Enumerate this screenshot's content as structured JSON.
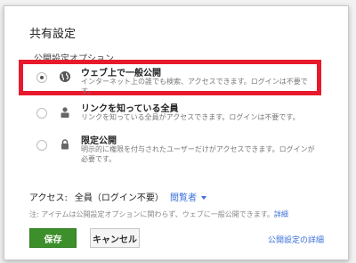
{
  "dialog": {
    "title": "共有設定",
    "options_label": "公開設定オプション",
    "options": [
      {
        "title": "ウェブ上で一般公開",
        "description": "インターネット上の誰でも検索、アクセスできます。ログインは不要です。",
        "icon": "globe-icon",
        "selected": true
      },
      {
        "title": "リンクを知っている全員",
        "description": "リンクを知っている全員がアクセスできます。ログインは不要です。",
        "icon": "people-icon",
        "selected": false
      },
      {
        "title": "限定公開",
        "description": "明示的に権限を付与されたユーザーだけがアクセスできます。ログインが必要です。",
        "icon": "lock-icon",
        "selected": false
      }
    ],
    "access_label": "アクセス:",
    "access_value": "全員（ログイン不要）",
    "role_value": "閲覧者",
    "note_text": "注: アイテムは公開設定オプションに関わらず、ウェブに一般公開できます。",
    "note_link": "詳細",
    "save_label": "保存",
    "cancel_label": "キャンセル",
    "details_link": "公開設定の詳細"
  },
  "colors": {
    "highlight": "#e8192c",
    "primary_button": "#3c8f2a",
    "link": "#3a6fd8"
  }
}
